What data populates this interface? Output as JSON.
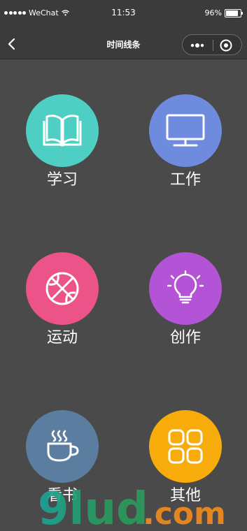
{
  "status_bar": {
    "carrier": "WeChat",
    "time": "11:53",
    "battery": "96%",
    "battery_level": 0.96,
    "signal_icon": "signal-dots-icon",
    "wifi_icon": "wifi-icon"
  },
  "nav": {
    "title": "时间线条",
    "back_icon": "chevron-left-icon",
    "more_icon": "more-dots-icon",
    "close_icon": "target-close-icon"
  },
  "categories": [
    {
      "label": "学习",
      "icon": "book-icon",
      "color": "#4fcfc4"
    },
    {
      "label": "工作",
      "icon": "monitor-icon",
      "color": "#6f8bdd"
    },
    {
      "label": "运动",
      "icon": "basketball-icon",
      "color": "#ec5388"
    },
    {
      "label": "创作",
      "icon": "lightbulb-icon",
      "color": "#b354d6"
    },
    {
      "label": "看书",
      "icon": "coffee-cup-icon",
      "color": "#5b7ea0"
    },
    {
      "label": "其他",
      "icon": "grid-icon",
      "color": "#f7ac0c"
    }
  ],
  "watermark": {
    "text": "9lud.com"
  }
}
